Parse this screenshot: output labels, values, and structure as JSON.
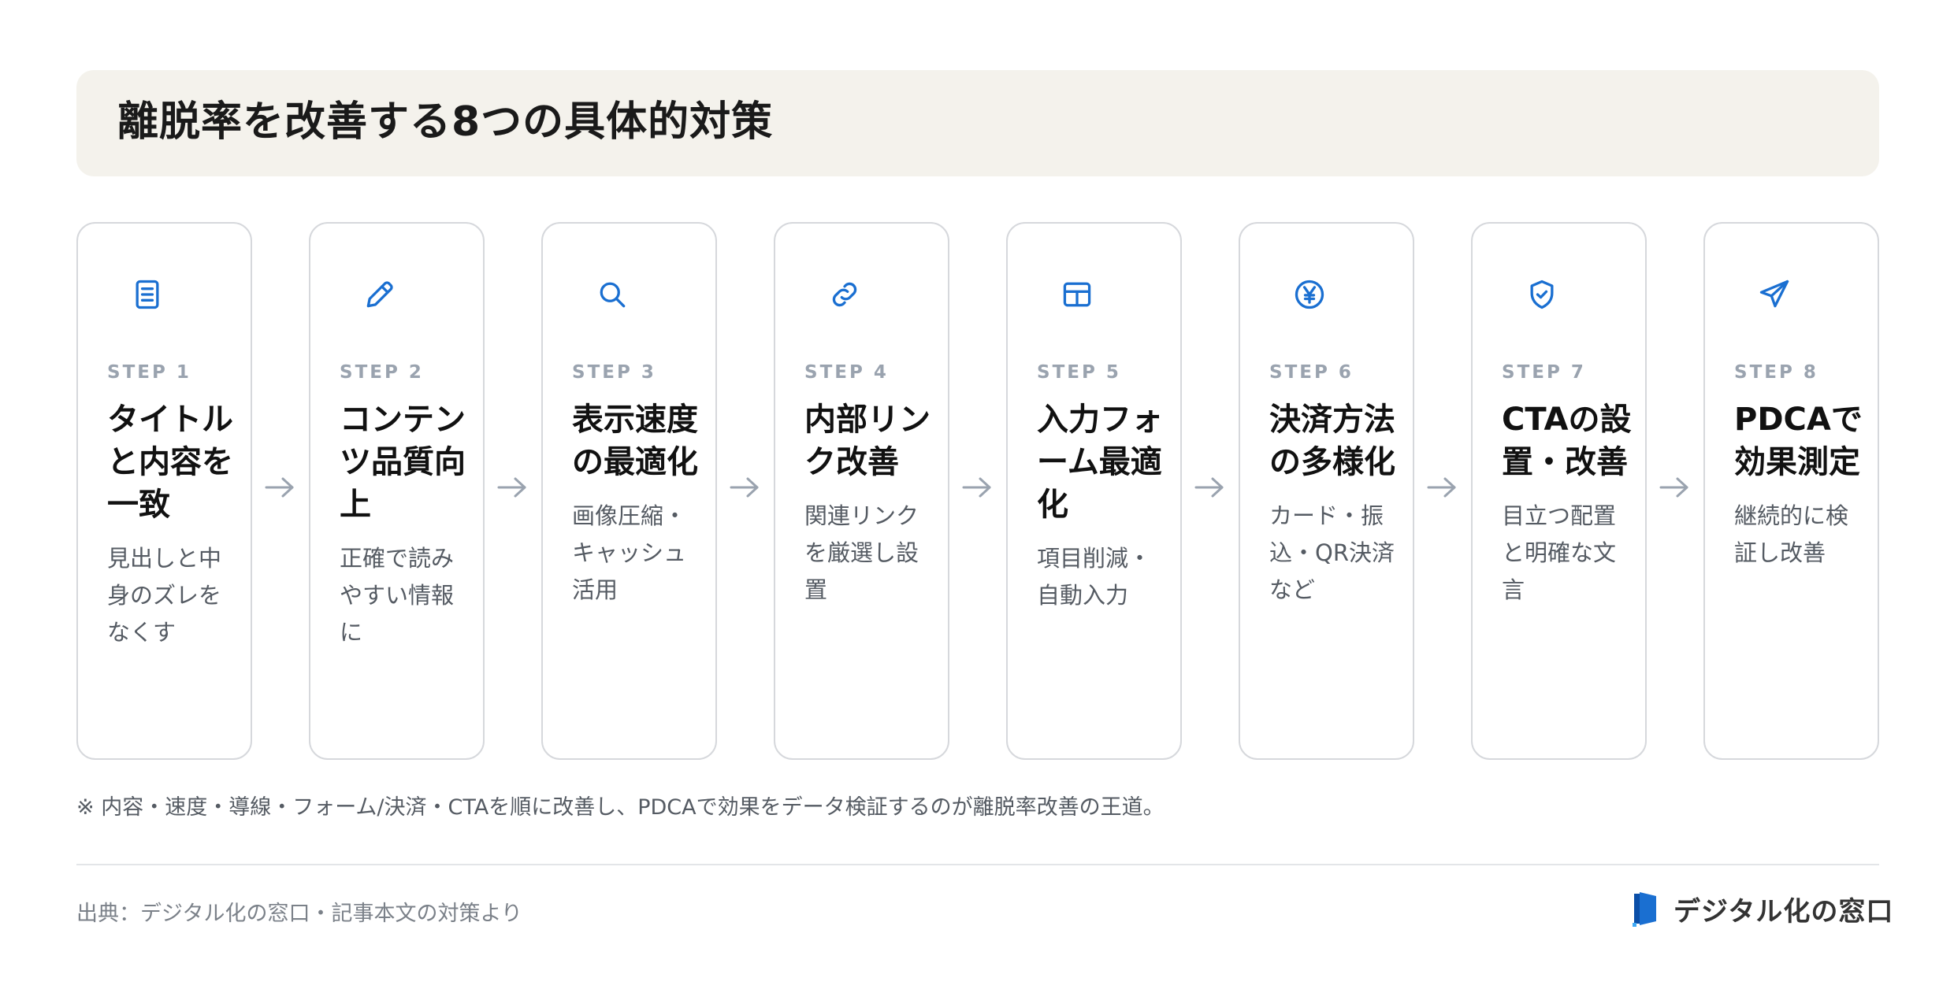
{
  "title": "離脱率を改善する8つの具体的対策",
  "colors": {
    "accent": "#1a6fd1",
    "title_bg": "#f4f2ec",
    "card_border": "#d6d8dc",
    "step_label": "#9aa3af",
    "arrow": "#9aa3af"
  },
  "steps": [
    {
      "label": "STEP 1",
      "title": "タイトルと内容を一致",
      "desc": "見出しと中身のズレをなくす",
      "icon": "document-icon"
    },
    {
      "label": "STEP 2",
      "title": "コンテンツ品質向上",
      "desc": "正確で読みやすい情報に",
      "icon": "pencil-icon"
    },
    {
      "label": "STEP 3",
      "title": "表示速度の最適化",
      "desc": "画像圧縮・キャッシュ活用",
      "icon": "search-icon"
    },
    {
      "label": "STEP 4",
      "title": "内部リンク改善",
      "desc": "関連リンクを厳選し設置",
      "icon": "link-icon"
    },
    {
      "label": "STEP 5",
      "title": "入力フォーム最適化",
      "desc": "項目削減・自動入力",
      "icon": "form-icon"
    },
    {
      "label": "STEP 6",
      "title": "決済方法の多様化",
      "desc": "カード・振込・QR決済など",
      "icon": "yen-icon"
    },
    {
      "label": "STEP 7",
      "title": "CTAの設置・改善",
      "desc": "目立つ配置と明確な文言",
      "icon": "shield-icon"
    },
    {
      "label": "STEP 8",
      "title": "PDCAで効果測定",
      "desc": "継続的に検証し改善",
      "icon": "send-icon"
    }
  ],
  "note": "※ 内容・速度・導線・フォーム/決済・CTAを順に改善し、PDCAで効果をデータ検証するのが離脱率改善の王道。",
  "source": "出典：デジタル化の窓口・記事本文の対策より",
  "brand": {
    "name": "デジタル化の窓口"
  }
}
